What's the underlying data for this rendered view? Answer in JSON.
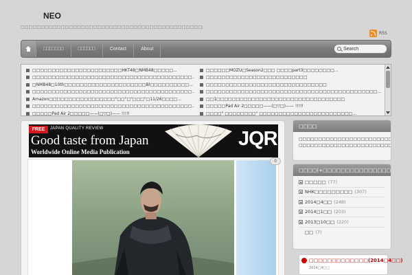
{
  "site": {
    "title": "NEO",
    "description": "□□□□□□□□□□□□□□□□□□□□□□□□□□□□□□□□□□□□□□□□□□□□□□□□□□□□□□□□□□□□□□□□□□",
    "rss_label": "RSS"
  },
  "nav": {
    "items": [
      {
        "label": "□□□□□□□"
      },
      {
        "label": "□□□□□□"
      },
      {
        "label": "Contact"
      },
      {
        "label": "About"
      }
    ],
    "search_value": "Search"
  },
  "ticker": {
    "left": [
      "□□□□□□□□□□□□□□□□□□□□□□□HKT48□NMB48□□□□□...",
      "□□□□□□□□□□□□□□□□□□□□□□□□□□□□□□□□□□□□□□□□□...",
      "□NMB48□10th□□□□□□□□□□□□□□□□□□□□□BI□□□□□□□□□□...",
      "□□□□□□□□□□□□□□□□□□□□□□□□□□□□□□□□□□□□□□□□□...",
      "Amazon□□□□□□□□□□□□□□□□□\"□□\"□\"□□□\"□11/26□□□□...",
      "□□□□□□□□□□□□□□□□□□□□□□□□□□□□□□□□□□□□□□□□□...",
      "□□□□□Pad Air 2□□□□□——(□▽□)—— !!!!!"
    ],
    "right": [
      "□□□□□□MOZU□Season2□□□ □□□□part3□□□□□□□□...",
      "□□□□□□□□□□□□□□□□□□□□□□□□□□",
      "□□□□□□□□□□□□□□□□□□□□□□□□□□□□□□□",
      "□□□□□□□□□□□□□□□□□□□□□□□□□□□□□□□□□□□□□□□□□□□□...",
      "□□1□□□□□□□□□□□□□□□□□□□□□□□□□□□□□□□□□",
      "□□□□□Pad Air 2□□□□□——(□▽□)—— !!!!!",
      "□□□□\" □□□□□□□□\" □□□□□□□□□□□□□□□□□□□□□□□□..."
    ]
  },
  "banner": {
    "free": "FREE",
    "review": "JAPAN QUALITY REVIEW",
    "slogan": "Good taste from Japan",
    "subtitle": "Worldwide Online Media Publication",
    "logo": "JQR"
  },
  "post": {
    "comment_count": "0"
  },
  "sidebar": {
    "about_title": "□□□□",
    "about_text": "□□□□□□□□□□□□□□□□□□□□□□□□□□□□□□□\"□□□□□□□□□□□□□□□□□□□□□□□□□□□□□□□□□□□□□□□□ □□□□□□□□□□□□□□□□□□□□□□□□□",
    "categories_title": "□□□□(+□□□□□□□□□□□□□□□□□)",
    "categories": [
      {
        "label": "□□□□□",
        "count": "(77)"
      },
      {
        "label": "NHK□□□□□□□□□",
        "count": "(307)"
      },
      {
        "label": "2014□4□□",
        "count": "(248)"
      },
      {
        "label": "2014□1□□",
        "count": "(203)"
      },
      {
        "label": "2013□10□□",
        "count": "(220)"
      },
      {
        "label": "□□",
        "count": "(7)"
      }
    ],
    "ranking_title": "□□□□□□□□□□□□□(2014□4□□)",
    "ranking_sub": "2014□4□□"
  },
  "colors": {
    "background": "#d6d6d6",
    "nav": "#7b7b7b",
    "rss": "#ef8c26",
    "banner_badge": "#d4191f"
  }
}
